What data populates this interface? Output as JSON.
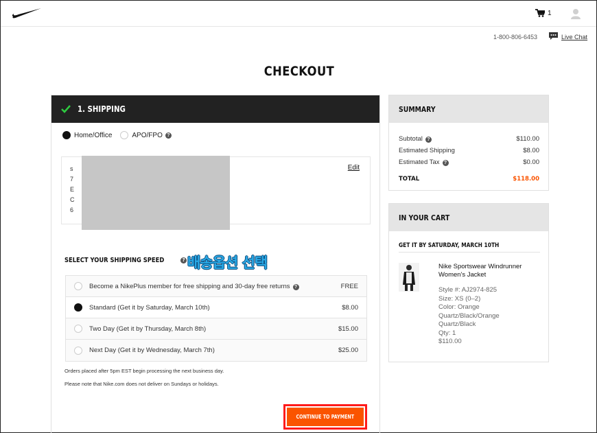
{
  "header": {
    "cart_count": "1",
    "phone": "1-800-806-6453",
    "live_chat": "Live Chat"
  },
  "page_title": "CHECKOUT",
  "shipping": {
    "step_label": "1. SHIPPING",
    "address_types": [
      {
        "label": "Home/Office",
        "selected": true
      },
      {
        "label": "APO/FPO",
        "selected": false
      }
    ],
    "address_lines": [
      "s",
      "7",
      "E",
      "C",
      "6"
    ],
    "edit_label": "Edit",
    "speed_heading": "SELECT YOUR SHIPPING SPEED",
    "annotation": "배송옵션 선택",
    "options": [
      {
        "label": "Become a NikePlus member for free shipping and 30-day free returns",
        "price": "FREE",
        "selected": false,
        "help": true
      },
      {
        "label": "Standard (Get it by Saturday, March 10th)",
        "price": "$8.00",
        "selected": true
      },
      {
        "label": "Two Day (Get it by Thursday, March 8th)",
        "price": "$15.00",
        "selected": false
      },
      {
        "label": "Next Day (Get it by Wednesday, March 7th)",
        "price": "$25.00",
        "selected": false
      }
    ],
    "note1": "Orders placed after 5pm EST begin processing the next business day.",
    "note2": "Please note that Nike.com does not deliver on Sundays or holidays.",
    "continue_label": "CONTINUE TO PAYMENT"
  },
  "summary": {
    "heading": "SUMMARY",
    "subtotal_label": "Subtotal",
    "subtotal": "$110.00",
    "shipping_label": "Estimated Shipping",
    "shipping": "$8.00",
    "tax_label": "Estimated Tax",
    "tax": "$0.00",
    "total_label": "TOTAL",
    "total": "$118.00"
  },
  "cart": {
    "heading": "IN YOUR CART",
    "delivery": "GET IT BY SATURDAY, MARCH 10TH",
    "product_name": "Nike Sportswear Windrunner Women's Jacket",
    "style": "Style #: AJ2974-825",
    "size": "Size: XS (0–2)",
    "color": "Color: Orange Quartz/Black/Orange Quartz/Black",
    "qty": "Qty: 1",
    "price": "$110.00"
  },
  "colors": {
    "accent": "#fa5400",
    "highlight_border": "#ff1a1a",
    "header_dark": "#222222",
    "check_green": "#2ecc40",
    "annotation_blue": "#2aa9e6"
  }
}
